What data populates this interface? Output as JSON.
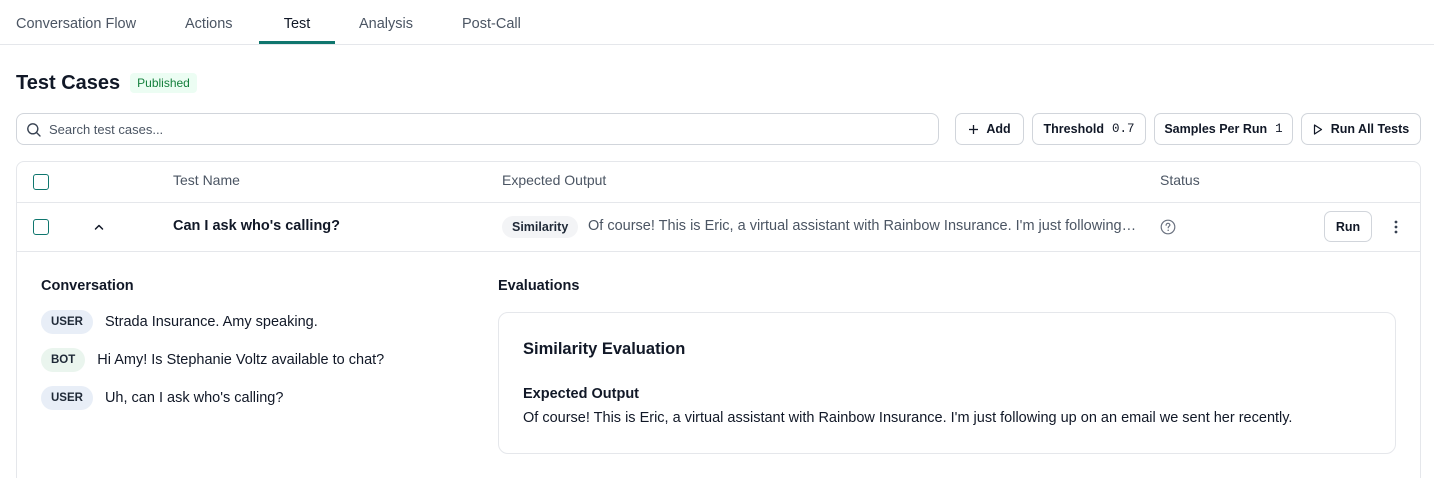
{
  "tabs": [
    {
      "label": "Conversation Flow"
    },
    {
      "label": "Actions"
    },
    {
      "label": "Test",
      "active": true
    },
    {
      "label": "Analysis"
    },
    {
      "label": "Post-Call"
    }
  ],
  "header": {
    "title": "Test Cases",
    "status_badge": "Published"
  },
  "search": {
    "placeholder": "Search test cases..."
  },
  "toolbar": {
    "add_label": "Add",
    "threshold_label": "Threshold",
    "threshold_value": "0.7",
    "samples_label": "Samples Per Run",
    "samples_value": "1",
    "run_all_label": "Run All Tests"
  },
  "table": {
    "columns": [
      "Test Name",
      "Expected Output",
      "Status"
    ],
    "rows": [
      {
        "name": "Can I ask who's calling?",
        "eval_type": "Similarity",
        "expected_output": "Of course! This is Eric, a virtual assistant with Rainbow Insurance. I'm just following up on an email we sent her recently.",
        "run_label": "Run",
        "expanded": true
      }
    ]
  },
  "detail": {
    "conversation_title": "Conversation",
    "messages": [
      {
        "role": "USER",
        "text": "Strada Insurance. Amy speaking."
      },
      {
        "role": "BOT",
        "text": "Hi Amy! Is Stephanie Voltz available to chat?"
      },
      {
        "role": "USER",
        "text": "Uh, can I ask who's calling?"
      }
    ],
    "evaluations_title": "Evaluations",
    "evaluation": {
      "title": "Similarity Evaluation",
      "label": "Expected Output",
      "text": "Of course! This is Eric, a virtual assistant with Rainbow Insurance. I'm just following up on an email we sent her recently."
    }
  },
  "colors": {
    "accent": "#0f766e",
    "published_bg": "#ecfdf3",
    "published_text": "#15803d"
  }
}
